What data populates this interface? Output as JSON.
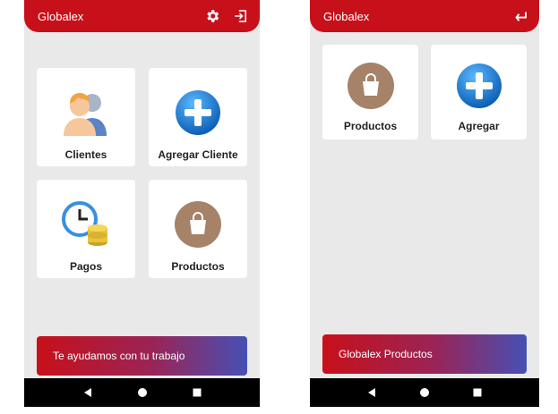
{
  "left": {
    "appbar": {
      "title": "Globalex",
      "settings_icon": "gear-icon",
      "logout_icon": "exit-icon"
    },
    "cards": [
      {
        "label": "Clientes",
        "icon": "users-icon"
      },
      {
        "label": "Agregar Cliente",
        "icon": "plus-circle-icon"
      },
      {
        "label": "Pagos",
        "icon": "clock-coins-icon"
      },
      {
        "label": "Productos",
        "icon": "shopping-bag-icon"
      }
    ],
    "banner": "Te ayudamos con tu trabajo"
  },
  "right": {
    "appbar": {
      "title": "Globalex",
      "back_icon": "return-arrow-icon"
    },
    "cards": [
      {
        "label": "Productos",
        "icon": "shopping-bag-icon"
      },
      {
        "label": "Agregar",
        "icon": "plus-circle-icon"
      }
    ],
    "banner": "Globalex Productos"
  },
  "navbar": {
    "back_icon": "triangle-back-icon",
    "home_icon": "circle-home-icon",
    "recents_icon": "square-recents-icon"
  },
  "colors": {
    "brand_red": "#c8101a",
    "gradient_end": "#4650b4",
    "background": "#e9e9e9",
    "plus_blue": "#1a7fd6",
    "bag_brown": "#a58268"
  }
}
